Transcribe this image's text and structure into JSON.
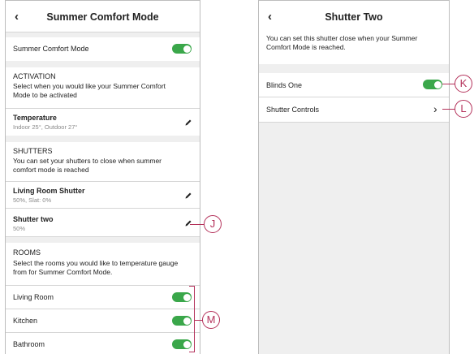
{
  "left_screen": {
    "title": "Summer Comfort Mode",
    "summer_comfort_label": "Summer Comfort Mode",
    "activation": {
      "heading": "ACTIVATION",
      "description_line1": "Select when you would like your Summer Comfort",
      "description_line2": "Mode to be activated"
    },
    "temperature": {
      "label": "Temperature",
      "detail": "Indoor 25°, Outdoor 27°"
    },
    "shutters": {
      "heading": "SHUTTERS",
      "description_line1": "You can set your shutters to close when summer",
      "description_line2": "comfort mode is reached",
      "items": [
        {
          "label": "Living Room Shutter",
          "detail": "50%, Slat: 0%"
        },
        {
          "label": "Shutter two",
          "detail": "50%"
        }
      ]
    },
    "rooms": {
      "heading": "ROOMS",
      "description_line1": "Select the rooms you would like to temperature gauge",
      "description_line2": "from for Summer Comfort Mode.",
      "items": [
        {
          "label": "Living Room"
        },
        {
          "label": "Kitchen"
        },
        {
          "label": "Bathroom"
        }
      ]
    }
  },
  "right_screen": {
    "title": "Shutter Two",
    "description_line1": "You can set this shutter close when your Summer",
    "description_line2": "Comfort Mode is reached.",
    "blinds_label": "Blinds One",
    "controls_label": "Shutter Controls"
  },
  "callouts": {
    "j": "J",
    "k": "K",
    "l": "L",
    "m": "M"
  },
  "colors": {
    "toggle_on": "#3aa74a",
    "callout": "#b4315a",
    "background": "#efefef"
  }
}
